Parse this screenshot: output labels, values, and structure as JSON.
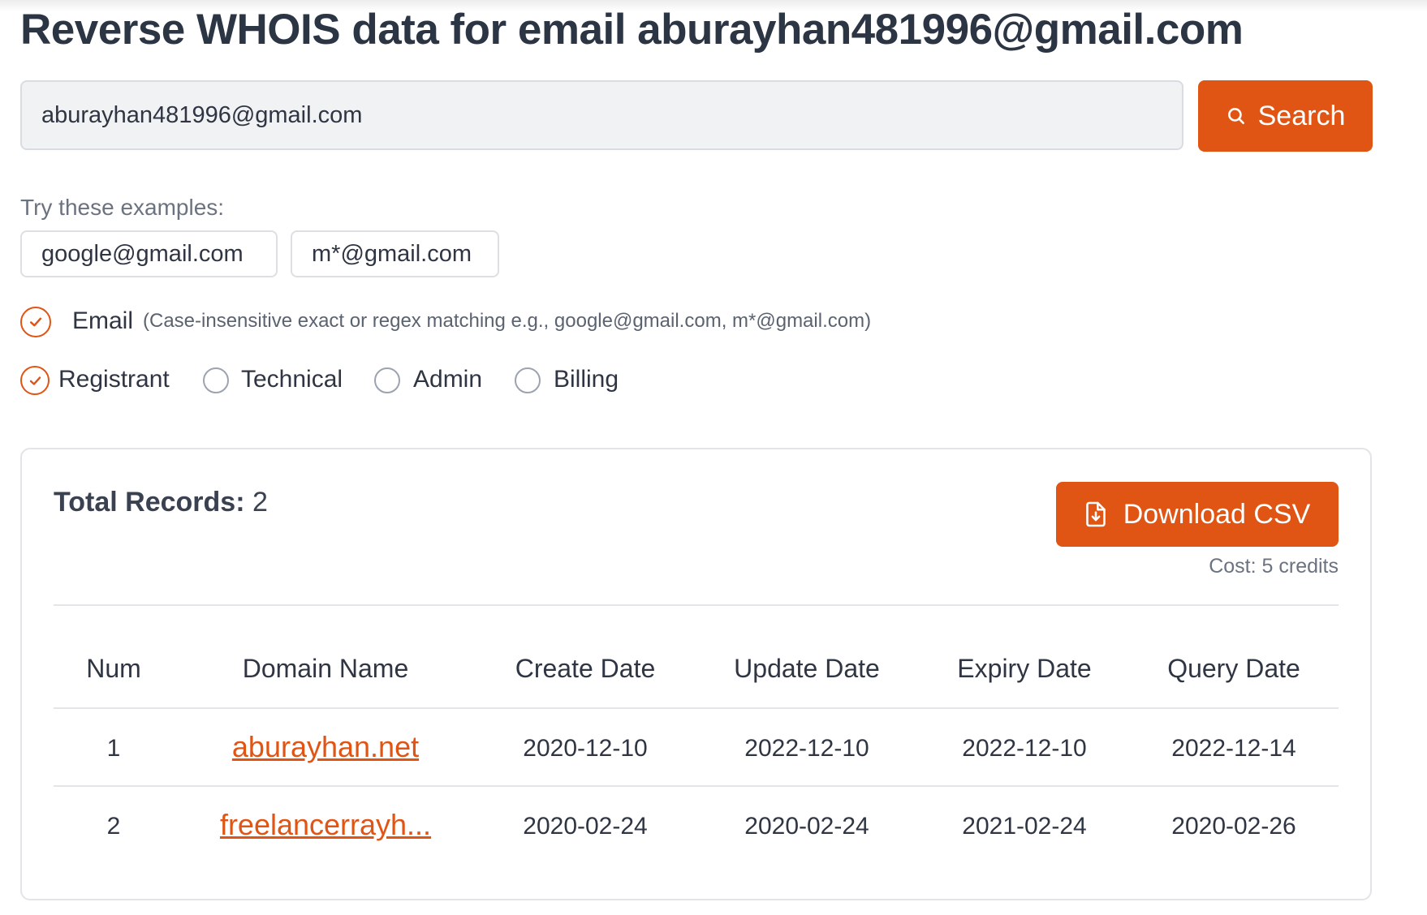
{
  "page": {
    "title": "Reverse WHOIS data for email aburayhan481996@gmail.com"
  },
  "search": {
    "value": "aburayhan481996@gmail.com",
    "button_label": "Search"
  },
  "examples": {
    "label": "Try these examples:",
    "items": [
      "google@gmail.com",
      "m*@gmail.com"
    ]
  },
  "filters": {
    "email": {
      "label": "Email",
      "hint": "(Case-insensitive exact or regex matching e.g., google@gmail.com, m*@gmail.com)",
      "checked": true
    },
    "contacts": [
      {
        "label": "Registrant",
        "checked": true
      },
      {
        "label": "Technical",
        "checked": false
      },
      {
        "label": "Admin",
        "checked": false
      },
      {
        "label": "Billing",
        "checked": false
      }
    ]
  },
  "results": {
    "total_label": "Total Records:",
    "total_value": "2",
    "download_label": "Download CSV",
    "cost": "Cost: 5 credits",
    "columns": [
      "Num",
      "Domain Name",
      "Create Date",
      "Update Date",
      "Expiry Date",
      "Query Date"
    ],
    "rows": [
      {
        "num": "1",
        "domain": "aburayhan.net",
        "create": "2020-12-10",
        "update": "2022-12-10",
        "expiry": "2022-12-10",
        "query": "2022-12-14"
      },
      {
        "num": "2",
        "domain": "freelancerrayh...",
        "create": "2020-02-24",
        "update": "2020-02-24",
        "expiry": "2021-02-24",
        "query": "2020-02-26"
      }
    ]
  },
  "theme": {
    "accent": "#e05414",
    "text": "#2c3544"
  },
  "icons": {
    "search": "search-icon",
    "download": "file-download-icon",
    "check": "check-circle-icon"
  }
}
